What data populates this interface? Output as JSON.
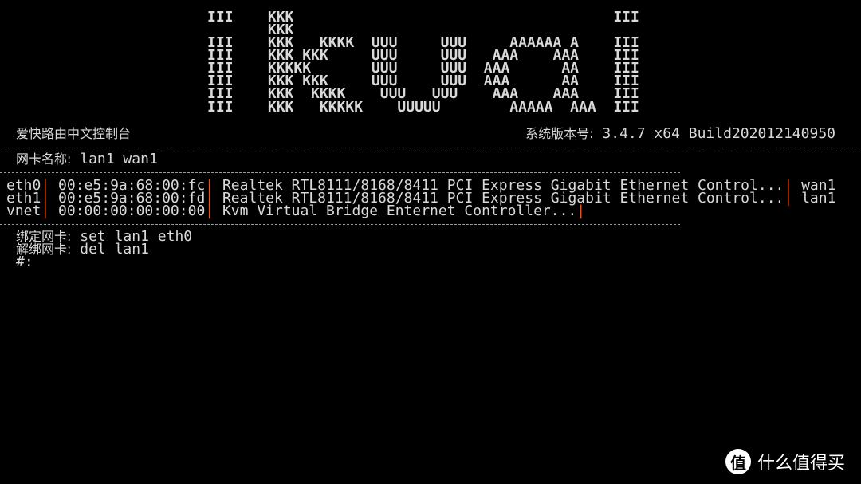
{
  "banner_art": [
    "III    KKK                                     III",
    "       KKK",
    "III    KKK   KKKK  UUU     UUU     AAAAAA A    III",
    "III    KKK KKK     UUU     UUU   AAA    AAA    III",
    "III    KKKKK       UUU     UUU  AAA      AA    III",
    "III    KKK KKK     UUU     UUU  AAA      AA    III",
    "III    KKK  KKKK    UUU   UUU    AAA    AAA    III",
    "III    KKK   KKKKK    UUUUU        AAAAA  AAA  III"
  ],
  "header": {
    "title": "爱快路由中文控制台",
    "version_label": "系统版本号:",
    "version_value": "3.4.7 x64 Build202012140950"
  },
  "nic_names": {
    "label": "网卡名称:",
    "value": "lan1 wan1"
  },
  "separator": "|",
  "interfaces": [
    {
      "name": "eth0",
      "mac": "00:e5:9a:68:00:fc",
      "desc": "Realtek RTL8111/8168/8411 PCI Express Gigabit Ethernet Control...",
      "bind": "wan1"
    },
    {
      "name": "eth1",
      "mac": "00:e5:9a:68:00:fd",
      "desc": "Realtek RTL8111/8168/8411 PCI Express Gigabit Ethernet Control...",
      "bind": "lan1"
    },
    {
      "name": "vnet",
      "mac": "00:00:00:00:00:00",
      "desc": "Kvm Virtual Bridge Enternet Controller...",
      "bind": ""
    }
  ],
  "help": [
    {
      "label": "绑定网卡:",
      "cmd": "set lan1 eth0"
    },
    {
      "label": "解绑网卡:",
      "cmd": "del lan1"
    }
  ],
  "prompt": "#:",
  "colors": {
    "text": "#d9d9d9",
    "separator": "#e0561c",
    "background": "#000000"
  },
  "watermark": {
    "logo_char": "值",
    "text": "什么值得买"
  }
}
